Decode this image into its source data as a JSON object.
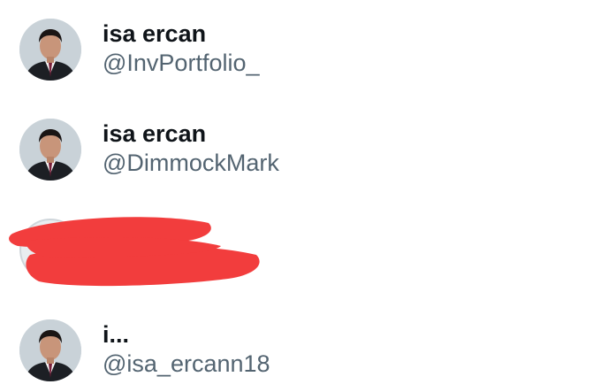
{
  "accounts": [
    {
      "name": "isa ercan",
      "handle": "@InvPortfolio_",
      "avatar_icon": "profile-photo"
    },
    {
      "name": "isa ercan",
      "handle": "@DimmockMark",
      "avatar_icon": "profile-photo"
    },
    {
      "name": "",
      "handle": "",
      "avatar_icon": "profile-photo",
      "redacted": true
    },
    {
      "name": "i...",
      "handle": "@isa_ercann18",
      "avatar_icon": "profile-photo"
    }
  ],
  "colors": {
    "name": "#0f1419",
    "handle": "#536471",
    "redaction": "#f23d3d",
    "background": "#ffffff"
  }
}
